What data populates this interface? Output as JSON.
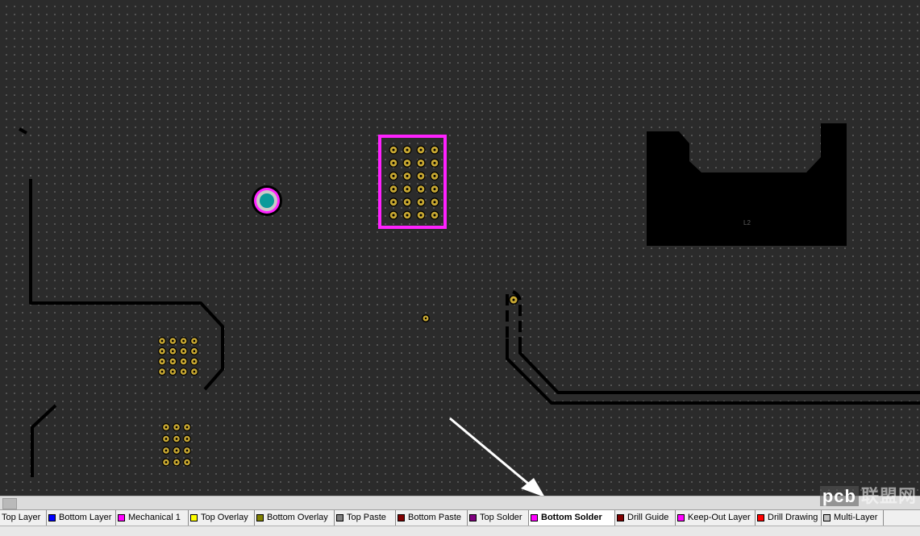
{
  "layer_tabs": [
    {
      "label": "Top Layer",
      "color": ""
    },
    {
      "label": "Bottom Layer",
      "color": "#0000ff"
    },
    {
      "label": "Mechanical 1",
      "color": "#ff00ff"
    },
    {
      "label": "Top Overlay",
      "color": "#ffff00"
    },
    {
      "label": "Bottom Overlay",
      "color": "#808000"
    },
    {
      "label": "Top Paste",
      "color": "#808080"
    },
    {
      "label": "Bottom Paste",
      "color": "#800000"
    },
    {
      "label": "Top Solder",
      "color": "#800080"
    },
    {
      "label": "Bottom Solder",
      "color": "#ff00ff",
      "active": true
    },
    {
      "label": "Drill Guide",
      "color": "#800000"
    },
    {
      "label": "Keep-Out Layer",
      "color": "#ff00ff"
    },
    {
      "label": "Drill Drawing",
      "color": "#ff0000"
    },
    {
      "label": "Multi-Layer",
      "color": "#c0c0c0"
    }
  ],
  "colors": {
    "board_background": "#2b2b2b",
    "track": "#000000",
    "pad_gold": "#c8a832",
    "solder_mask_highlight": "#ff22ff",
    "via_center": "#0a9a9a"
  },
  "designator": "L2",
  "watermark": {
    "brand": "pcb",
    "text": "联盟网"
  }
}
